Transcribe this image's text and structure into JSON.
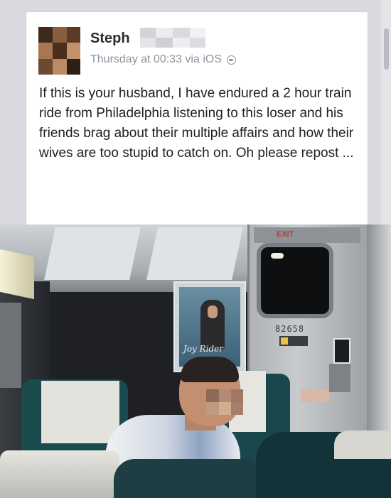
{
  "post": {
    "author_name": "Steph",
    "timestamp": "Thursday at 00:33 via iOS",
    "visibility_icon": "globe-icon",
    "text": "If this is your husband, I have endured a 2 hour train ride from Philadelphia listening to this loser and his friends brag about their multiple affairs and how their wives are too stupid to catch on. Oh please repost ..."
  },
  "photo": {
    "poster_caption": "Joy Rider",
    "door_number": "82658",
    "exit_sign": "EXIT"
  },
  "colors": {
    "name": "#2b2b2b",
    "meta": "#8d949e",
    "body_text": "#1c1e21",
    "card_bg": "#ffffff"
  }
}
